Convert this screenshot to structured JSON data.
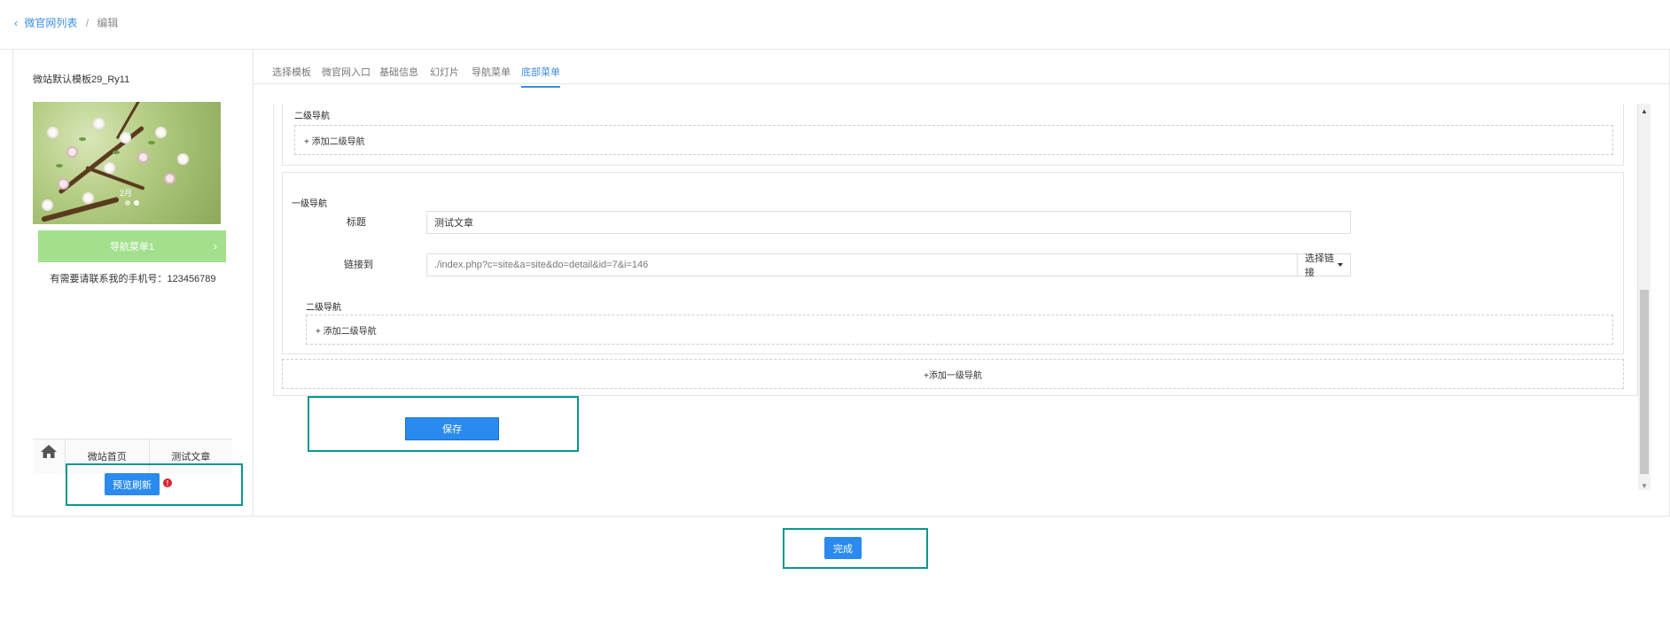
{
  "breadcrumb": {
    "parent": "微官网列表",
    "separator": "/",
    "current": "编辑"
  },
  "preview": {
    "site_name": "微站默认模板29_Ry11",
    "banner_caption": "2月",
    "nav_button": "导航菜单1",
    "phone_text": "有需要请联系我的手机号：123456789",
    "bottom_nav": [
      "微站首页",
      "测试文章"
    ],
    "refresh_button": "预览刷新",
    "warn_symbol": "!"
  },
  "tabs": [
    "选择模板",
    "微官网入口",
    "基础信息",
    "幻灯片",
    "导航菜单",
    "底部菜单"
  ],
  "active_tab": "底部菜单",
  "editor": {
    "secondary_nav_label": "二级导航",
    "add_secondary": "+ 添加二级导航",
    "primary_nav_label": "一级导航",
    "title_label": "标题",
    "title_value": "测试文章",
    "link_label": "链接到",
    "link_value": "./index.php?c=site&a=site&do=detail&id=7&i=146",
    "select_link": "选择链接",
    "add_primary": "+添加一级导航"
  },
  "save_button": "保存",
  "done_button": "完成",
  "colors": {
    "accent": "#2a8af0",
    "highlight_box": "#0a9692",
    "nav_button": "#a3e08d"
  }
}
